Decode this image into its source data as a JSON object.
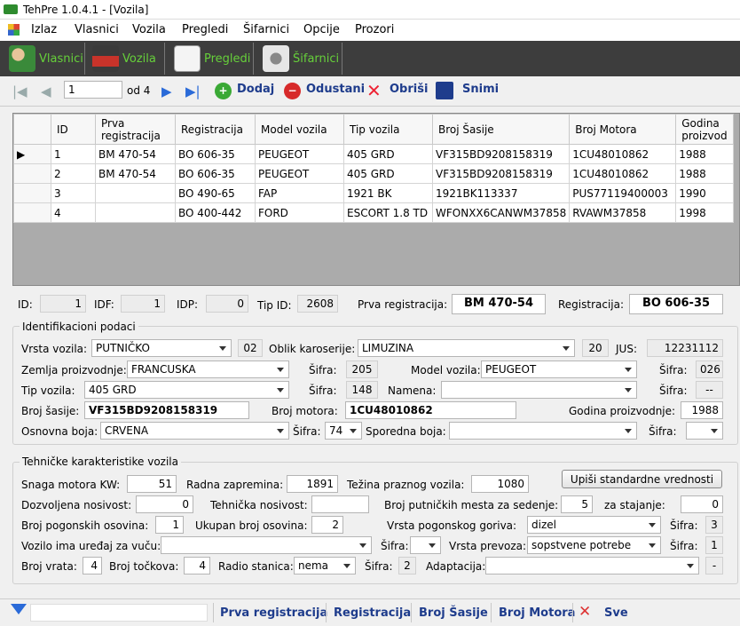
{
  "window": {
    "title": "TehPre 1.0.4.1 - [Vozila]"
  },
  "menu": [
    "Izlaz",
    "Vlasnici",
    "Vozila",
    "Pregledi",
    "Šifarnici",
    "Opcije",
    "Prozori"
  ],
  "nav": [
    "Vlasnici",
    "Vozila",
    "Pregledi",
    "Šifarnici"
  ],
  "toolbar": {
    "record": "1",
    "of": "od 4",
    "add": "Dodaj",
    "cancel": "Odustani",
    "delete": "Obriši",
    "save": "Snimi"
  },
  "grid": {
    "columns": [
      "ID",
      "Prva registracija",
      "Registracija",
      "Model vozila",
      "Tip vozila",
      "Broj Šasije",
      "Broj Motora",
      "Godina proizvod"
    ],
    "rows": [
      [
        "1",
        "BM 470-54",
        "BO 606-35",
        "PEUGEOT",
        "405 GRD",
        "VF315BD9208158319",
        "1CU48010862",
        "1988"
      ],
      [
        "2",
        "BM 470-54",
        "BO 606-35",
        "PEUGEOT",
        "405 GRD",
        "VF315BD9208158319",
        "1CU48010862",
        "1988"
      ],
      [
        "3",
        "",
        "BO 490-65",
        "FAP",
        "1921 BK",
        "1921BK113337",
        "PUS77119400003",
        "1990"
      ],
      [
        "4",
        "",
        "BO 400-442",
        "FORD",
        "ESCORT 1.8 TD",
        "WFONXX6CANWM37858",
        "RVAWM37858",
        "1998"
      ]
    ]
  },
  "ids": {
    "id_label": "ID:",
    "id": "1",
    "idf_label": "IDF:",
    "idf": "1",
    "idp_label": "IDP:",
    "idp": "0",
    "tip_label": "Tip ID:",
    "tip": "2608",
    "prva_label": "Prva registracija:",
    "prva": "BM 470-54",
    "reg_label": "Registracija:",
    "reg": "BO 606-35"
  },
  "ident": {
    "title": "Identifikacioni podaci",
    "vrsta_label": "Vrsta vozila:",
    "vrsta": "PUTNIČKO",
    "vrsta_code": "02",
    "oblik_label": "Oblik karoserije:",
    "oblik": "LIMUZINA",
    "oblik_code": "20",
    "jus_label": "JUS:",
    "jus": "12231112",
    "zemlja_label": "Zemlja proizvodnje:",
    "zemlja": "FRANCUSKA",
    "sifra_label": "Šifra:",
    "zemlja_code": "205",
    "model_label": "Model vozila:",
    "model": "PEUGEOT",
    "model_code": "026",
    "tip_label": "Tip vozila:",
    "tip": "405 GRD",
    "tip_code": "148",
    "namena_label": "Namena:",
    "namena": "",
    "namena_code": "--",
    "sasija_label": "Broj šasije:",
    "sasija": "VF315BD9208158319",
    "motor_label": "Broj motora:",
    "motor": "1CU48010862",
    "godina_label": "Godina proizvodnje:",
    "godina": "1988",
    "osnovna_label": "Osnovna boja:",
    "osnovna": "CRVENA",
    "osnovna_code": "74",
    "sporedna_label": "Sporedna boja:",
    "sporedna": "",
    "sporedna_code": ""
  },
  "tech": {
    "title": "Tehničke karakteristike vozila",
    "std_button": "Upiši standardne vrednosti",
    "snaga_label": "Snaga motora KW:",
    "snaga": "51",
    "zapremina_label": "Radna zapremina:",
    "zapremina": "1891",
    "tezina_label": "Težina praznog vozila:",
    "tezina": "1080",
    "doz_label": "Dozvoljena nosivost:",
    "doz": "0",
    "teh_label": "Tehnička nosivost:",
    "teh": "",
    "mesta_label": "Broj putničkih mesta  za sedenje:",
    "sedenje": "5",
    "stajanje_label": "za stajanje:",
    "stajanje": "0",
    "pog_label": "Broj pogonskih osovina:",
    "pog": "1",
    "ukupno_label": "Ukupan broj osovina:",
    "ukupno": "2",
    "gorivo_label": "Vrsta pogonskog goriva:",
    "gorivo": "dizel",
    "sifra_label": "Šifra:",
    "gorivo_code": "3",
    "vuca_label": "Vozilo ima uređaj za vuču:",
    "vuca": "",
    "vuca_code": "",
    "prevoz_label": "Vrsta prevoza:",
    "prevoz": "sopstvene potrebe",
    "prevoz_code": "1",
    "vrata_label": "Broj vrata:",
    "vrata": "4",
    "tockova_label": "Broj točkova:",
    "tockova": "4",
    "radio_label": "Radio stanica:",
    "radio": "nema",
    "radio_code": "2",
    "adapt_label": "Adaptacija:",
    "adapt": "",
    "adapt_code": "-"
  },
  "status": {
    "filter": "",
    "links": [
      "Prva registracija",
      "Registracija",
      "Broj Šasije",
      "Broj Motora"
    ],
    "all": "Sve"
  }
}
